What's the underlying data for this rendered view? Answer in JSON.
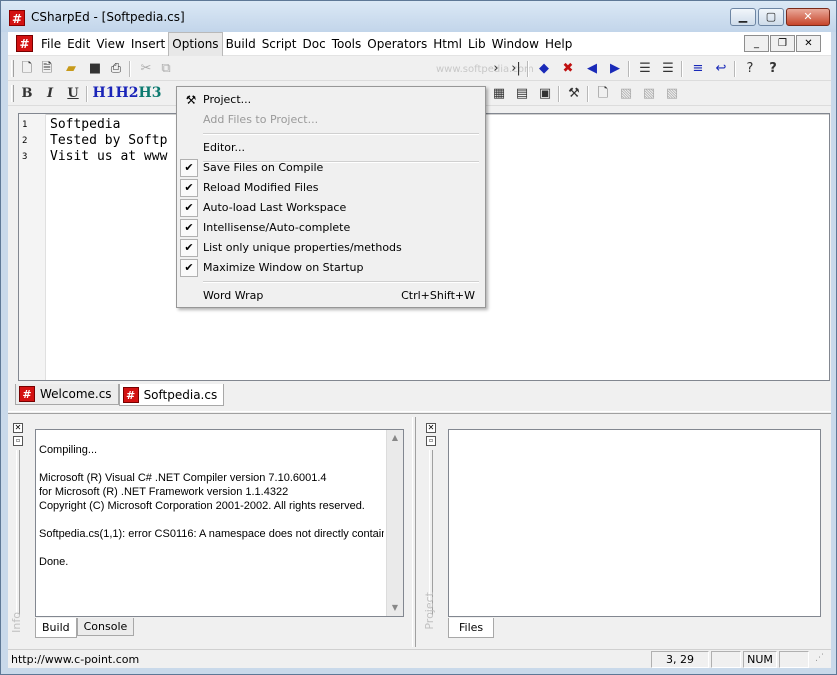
{
  "window": {
    "title": "CSharpEd - [Softpedia.cs]",
    "app_icon": "#",
    "minimize": "▁",
    "maximize": "▢",
    "close": "✕"
  },
  "menubar": {
    "items": [
      "File",
      "Edit",
      "View",
      "Insert",
      "Options",
      "Build",
      "Script",
      "Doc",
      "Tools",
      "Operators",
      "Html",
      "Lib",
      "Window",
      "Help"
    ],
    "active": "Options",
    "mdi_minimize": "_",
    "mdi_restore": "❐",
    "mdi_close": "✕"
  },
  "toolbar": {
    "watermark": "www.softpedia.com",
    "bold": "B",
    "italic": "I",
    "underline": "U",
    "h1": "H1",
    "h2": "H2",
    "h3": "H3"
  },
  "editor": {
    "lines": [
      {
        "num": "1",
        "text": "Softpedia"
      },
      {
        "num": "2",
        "text": "Tested by Softp"
      },
      {
        "num": "3",
        "text": "Visit us at www"
      }
    ]
  },
  "doc_tabs": [
    "Welcome.cs",
    "Softpedia.cs"
  ],
  "active_doc_tab": "Softpedia.cs",
  "options_menu": {
    "project": "Project...",
    "add_files": "Add Files to Project...",
    "editor": "Editor...",
    "save_on_compile": "Save Files on Compile",
    "reload_modified": "Reload Modified Files",
    "autoload_workspace": "Auto-load Last Workspace",
    "intellisense": "Intellisense/Auto-complete",
    "unique_props": "List only unique properties/methods",
    "maximize_startup": "Maximize Window on Startup",
    "word_wrap": "Word Wrap",
    "word_wrap_shortcut": "Ctrl+Shift+W",
    "check": "✔"
  },
  "build_pane": {
    "side_label": "Info",
    "output": "Compiling...\n\nMicrosoft (R) Visual C# .NET Compiler version 7.10.6001.4\nfor Microsoft (R) .NET Framework version 1.1.4322\nCopyright (C) Microsoft Corporation 2001-2002. All rights reserved.\n\nSoftpedia.cs(1,1): error CS0116: A namespace does not directly contain\n\nDone.",
    "tabs": [
      "Build",
      "Console"
    ]
  },
  "project_pane": {
    "side_label": "Project",
    "tabs": [
      "Files"
    ]
  },
  "statusbar": {
    "url": "http://www.c-point.com",
    "position": "3, 29",
    "num": "NUM"
  }
}
